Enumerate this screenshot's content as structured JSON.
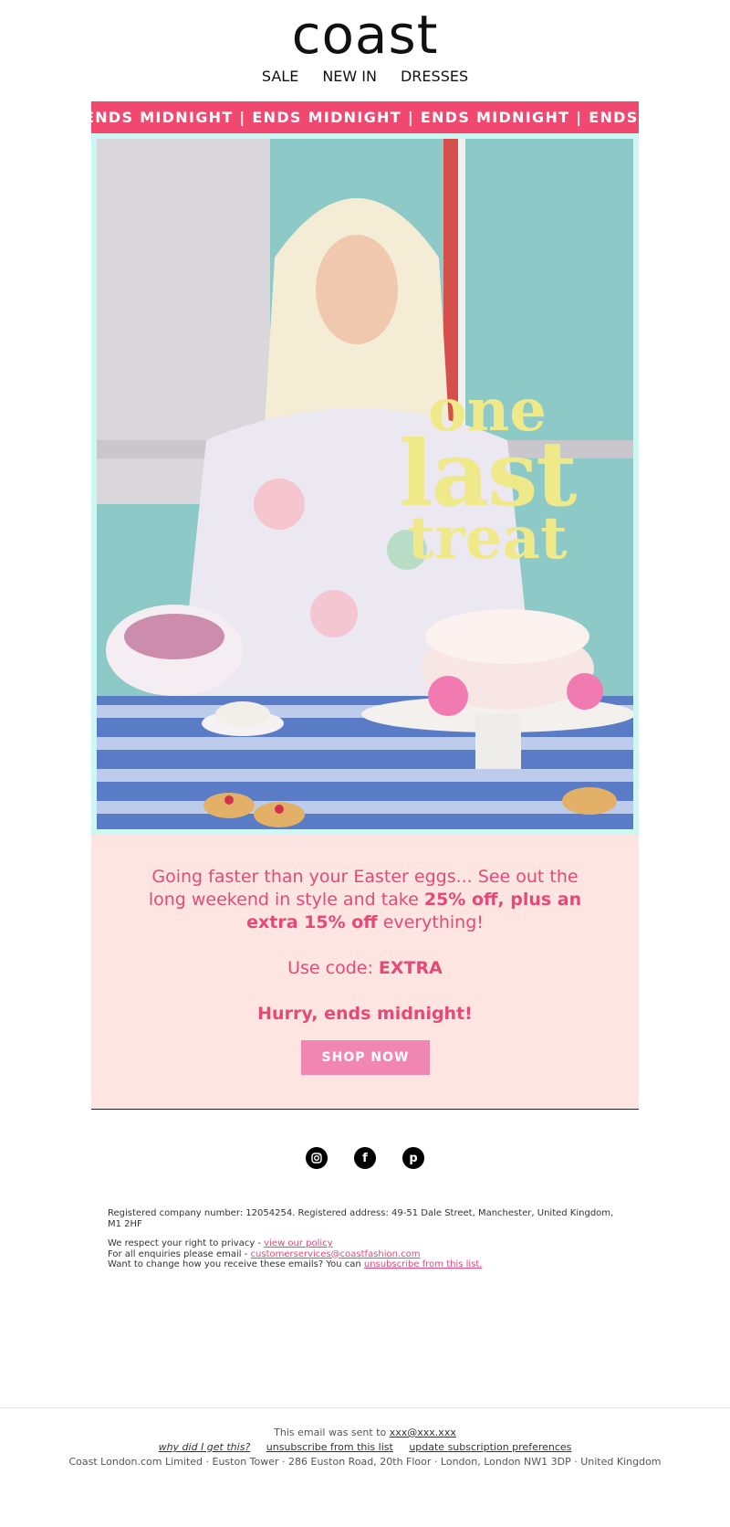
{
  "header": {
    "logo": "coast"
  },
  "nav": {
    "items": [
      "SALE",
      "NEW IN",
      "DRESSES"
    ]
  },
  "ticker": {
    "text": "ENDS MIDNIGHT  |  ENDS MIDNIGHT  |  ENDS MIDNIGHT  |  ENDS MIDNIGHT",
    "bg_color": "#f0486e"
  },
  "hero": {
    "line1": "one",
    "line2": "last",
    "line3": "treat",
    "text_color": "#efe98a"
  },
  "promo": {
    "body_pre": "Going faster than your Easter eggs... See out the long weekend in style and take ",
    "body_bold": "25% off, plus an extra 15% off",
    "body_post": " everything!",
    "code_label": "Use code: ",
    "code": "EXTRA",
    "hurry": "Hurry, ends midnight!",
    "button": "SHOP NOW",
    "bg_color": "#fde6e1",
    "text_color": "#e64877"
  },
  "social": {
    "icons": [
      "instagram-icon",
      "facebook-icon",
      "pinterest-icon"
    ]
  },
  "legal": {
    "line1": "Registered company number: 12054254. Registered address: 49-51 Dale Street, Manchester, United Kingdom, M1 2HF",
    "privacy_pre": "We respect your right to privacy - ",
    "privacy_link": "view our policy",
    "enquiry_pre": "For all enquiries please email - ",
    "enquiry_link": "customerservices@coastfashion.com",
    "unsub_pre": "Want to change how you receive these emails? You can ",
    "unsub_link": "unsubscribe from this list."
  },
  "footer": {
    "sent_pre": "This email was sent to ",
    "sent_email": "xxx@xxx.xxx",
    "why": "why did I get this?",
    "unsubscribe": "unsubscribe from this list",
    "preferences": "update subscription preferences",
    "address": "Coast London.com Limited · Euston Tower · 286 Euston Road, 20th Floor · London, London NW1 3DP · United Kingdom"
  }
}
